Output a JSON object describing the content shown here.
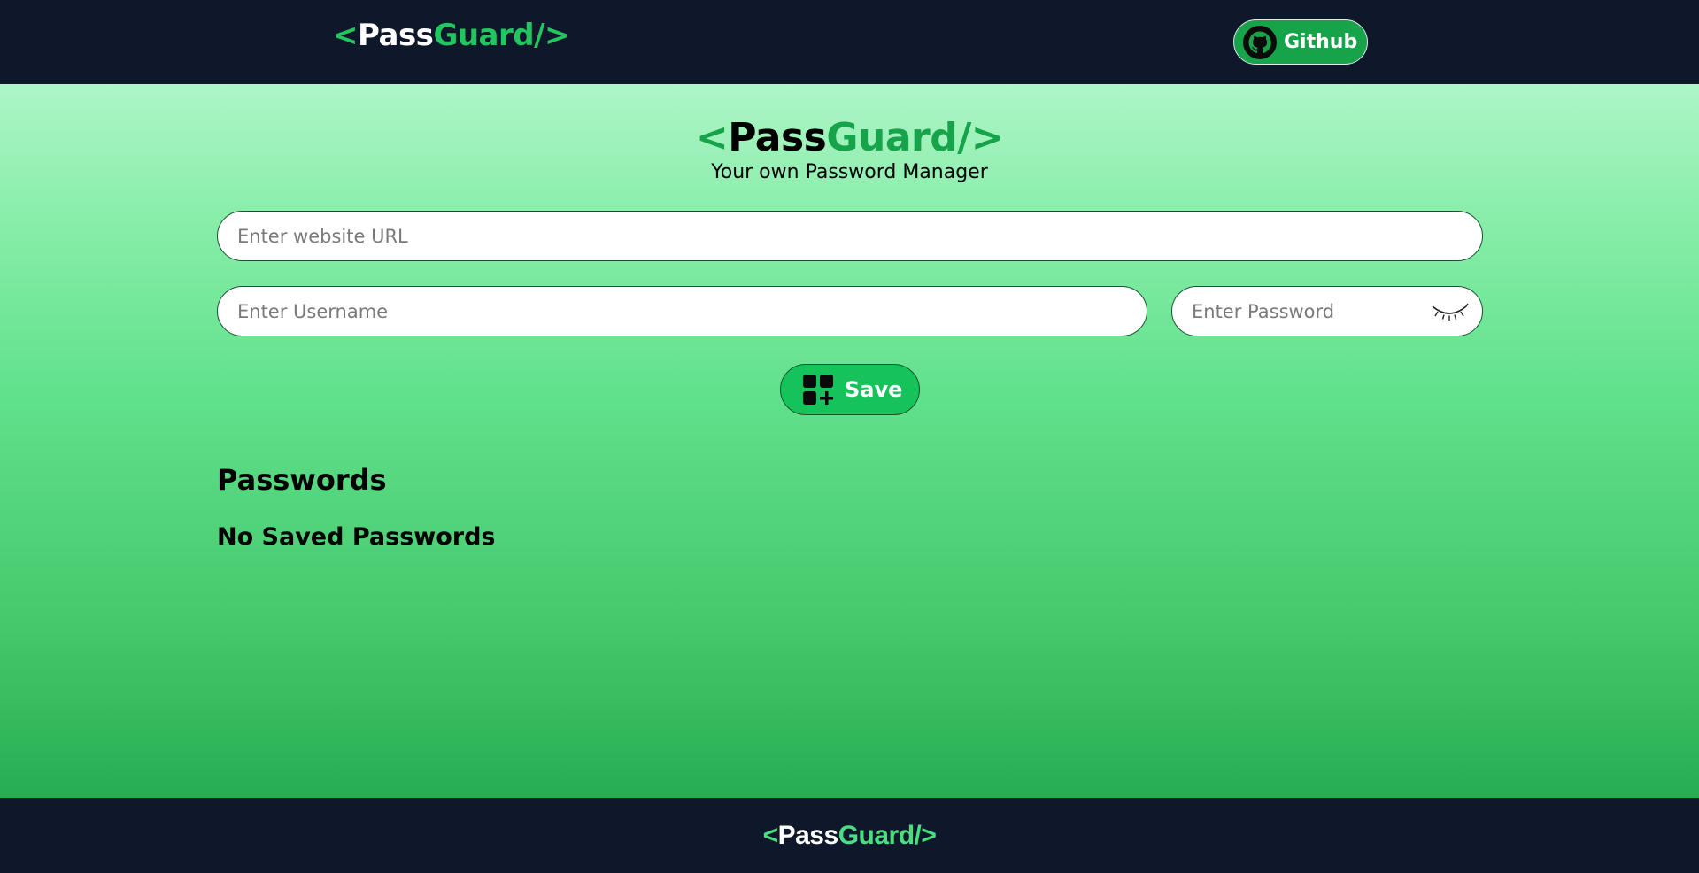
{
  "navbar": {
    "logo": {
      "open": "<",
      "main": "Pass",
      "accent": "Guard",
      "close": "/>"
    },
    "github_label": "Github",
    "github_icon": "github-icon"
  },
  "hero": {
    "logo": {
      "open": "<",
      "main": "Pass",
      "accent": "Guard",
      "close": "/>"
    },
    "tagline": "Your own Password Manager"
  },
  "form": {
    "url_placeholder": "Enter website URL",
    "url_value": "",
    "username_placeholder": "Enter Username",
    "username_value": "",
    "password_placeholder": "Enter Password",
    "password_value": "",
    "toggle_icon": "eye-closed-icon",
    "save_label": "Save",
    "save_icon": "add-grid-icon"
  },
  "passwords": {
    "title": "Passwords",
    "empty_message": "No Saved Passwords"
  },
  "footer": {
    "logo": {
      "open": "<",
      "main": "Pass",
      "accent": "Guard",
      "close": "/>"
    }
  },
  "colors": {
    "nav_bg": "#0f172a",
    "accent": "#22c55e",
    "button_green": "#16a34a"
  }
}
